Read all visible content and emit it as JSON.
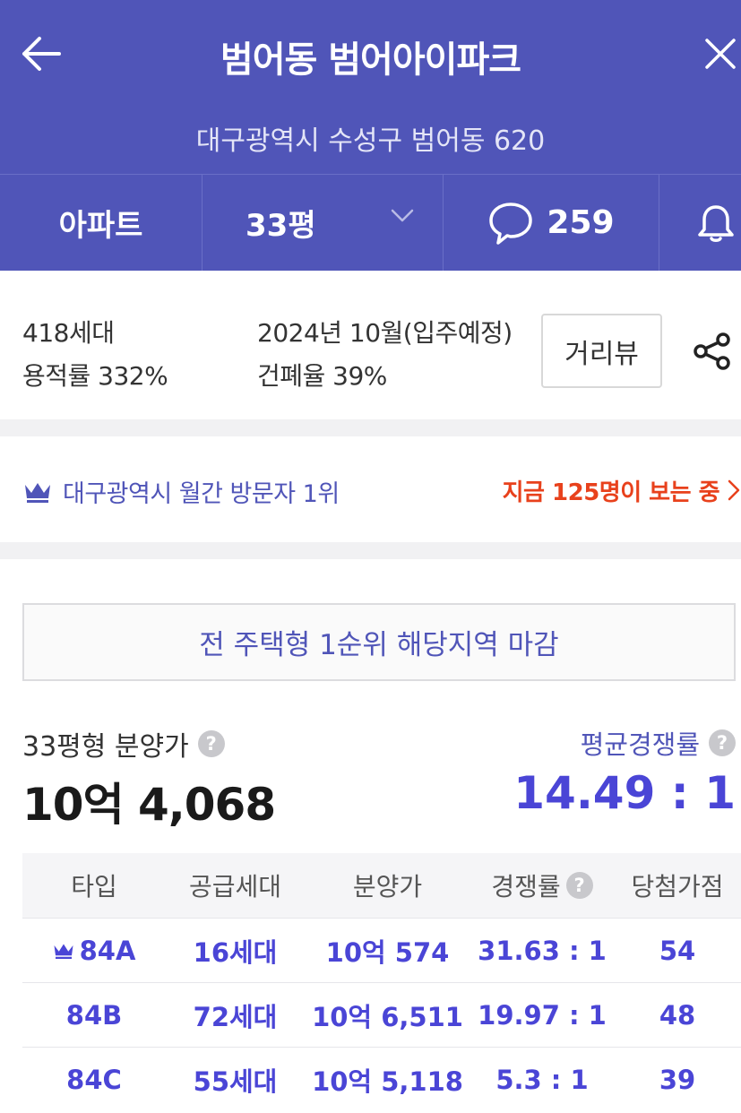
{
  "header": {
    "title": "범어동 범어아이파크",
    "address": "대구광역시 수성구 범어동 620"
  },
  "tabs": {
    "type_label": "아파트",
    "size_label": "33평",
    "comment_count": "259"
  },
  "summary": {
    "households": "418세대",
    "floor_area_ratio": "용적률 332%",
    "move_in": "2024년 10월(입주예정)",
    "building_coverage": "건폐율 39%",
    "street_view_label": "거리뷰"
  },
  "rank": {
    "text": "대구광역시 월간 방문자 1위",
    "viewers": "지금 125명이 보는 중"
  },
  "notice": "전 주택형 1순위 해당지역 마감",
  "price": {
    "label": "33평형 분양가",
    "value": "10억 4,068",
    "comp_label": "평균경쟁률",
    "comp_value": "14.49 : 1"
  },
  "table": {
    "headers": [
      "타입",
      "공급세대",
      "분양가",
      "경쟁률",
      "당첨가점"
    ],
    "rows": [
      [
        "84A",
        "16세대",
        "10억 574",
        "31.63 : 1",
        "54"
      ],
      [
        "84B",
        "72세대",
        "10억 6,511",
        "19.97 : 1",
        "48"
      ],
      [
        "84C",
        "55세대",
        "10억 5,118",
        "5.3 : 1",
        "39"
      ]
    ]
  },
  "help_glyph": "?",
  "colors": {
    "brand": "#5055b8",
    "accent_blue": "#4a45d6",
    "alert_red": "#e8411c"
  }
}
